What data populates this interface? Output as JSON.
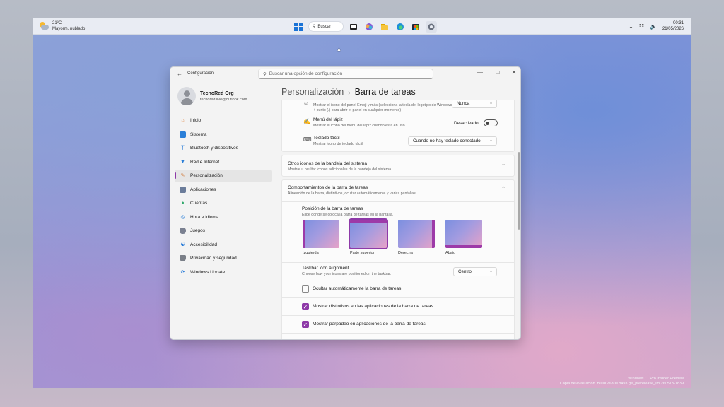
{
  "taskbar": {
    "weather_temp": "21ºC",
    "weather_desc": "Mayorm. nublado",
    "search_label": "Buscar",
    "clock_time": "00:31",
    "clock_date": "21/05/2026"
  },
  "window": {
    "app_title": "Configuración",
    "search_placeholder": "Buscar una opción de configuración"
  },
  "profile": {
    "name": "TecnoRed Org",
    "email": "tecnored.live@outlook.com"
  },
  "sidebar": {
    "items": [
      {
        "label": "Inicio"
      },
      {
        "label": "Sistema"
      },
      {
        "label": "Bluetooth y dispositivos"
      },
      {
        "label": "Red e Internet"
      },
      {
        "label": "Personalización"
      },
      {
        "label": "Aplicaciones"
      },
      {
        "label": "Cuentas"
      },
      {
        "label": "Hora e idioma"
      },
      {
        "label": "Juegos"
      },
      {
        "label": "Accesibilidad"
      },
      {
        "label": "Privacidad y seguridad"
      },
      {
        "label": "Windows Update"
      }
    ]
  },
  "header": {
    "crumb": "Personalización",
    "title": "Barra de tareas"
  },
  "rows": {
    "emoji_desc": "Mostrar el icono del panel Emoji y más (selecciona la tecla del logotipo de Windows + punto (.) para abrir el panel en cualquier momento)",
    "emoji_value": "Nunca",
    "pen_title": "Menú del lápiz",
    "pen_desc": "Mostrar el icono del menú del lápiz cuando está en uso",
    "pen_state": "Desactivado",
    "kb_title": "Teclado táctil",
    "kb_desc": "Mostrar icono de teclado táctil",
    "kb_value": "Cuando no hay teclado conectado"
  },
  "tray_card": {
    "title": "Otros iconos de la bandeja del sistema",
    "desc": "Mostrar u ocultar iconos adicionales de la bandeja del sistema"
  },
  "behavior_card": {
    "title": "Comportamientos de la barra de tareas",
    "desc": "Alineación de la barra, distintivos, ocultar automáticamente y varias pantallas",
    "position_title": "Posición de la barra de tareas",
    "position_desc": "Elige dónde se coloca la barra de tareas en la pantalla.",
    "positions": [
      "Izquierda",
      "Parte superior",
      "Derecha",
      "Abajo"
    ],
    "selected_position": "Parte superior",
    "align_title": "Taskbar icon alignment",
    "align_desc": "Choose how your icons are positioned on the taskbar.",
    "align_value": "Centro",
    "autohide_label": "Ocultar automáticamente la barra de tareas",
    "autohide_checked": false,
    "badges_label": "Mostrar distintivos en las aplicaciones de la barra de tareas",
    "badges_checked": true,
    "flash_label": "Mostrar parpadeo en aplicaciones de la barra de tareas",
    "flash_checked": true
  },
  "watermark": {
    "line1": "Windows 11 Pro Insider Preview",
    "line2": "Copia de evaluación. Build 26300.8493.ge_prerelease_im.260513-1839"
  },
  "colors": {
    "accent": "#8e3aa8",
    "taskbar_bg": "#e9ecf3",
    "window_bg": "#f3f3f3"
  }
}
